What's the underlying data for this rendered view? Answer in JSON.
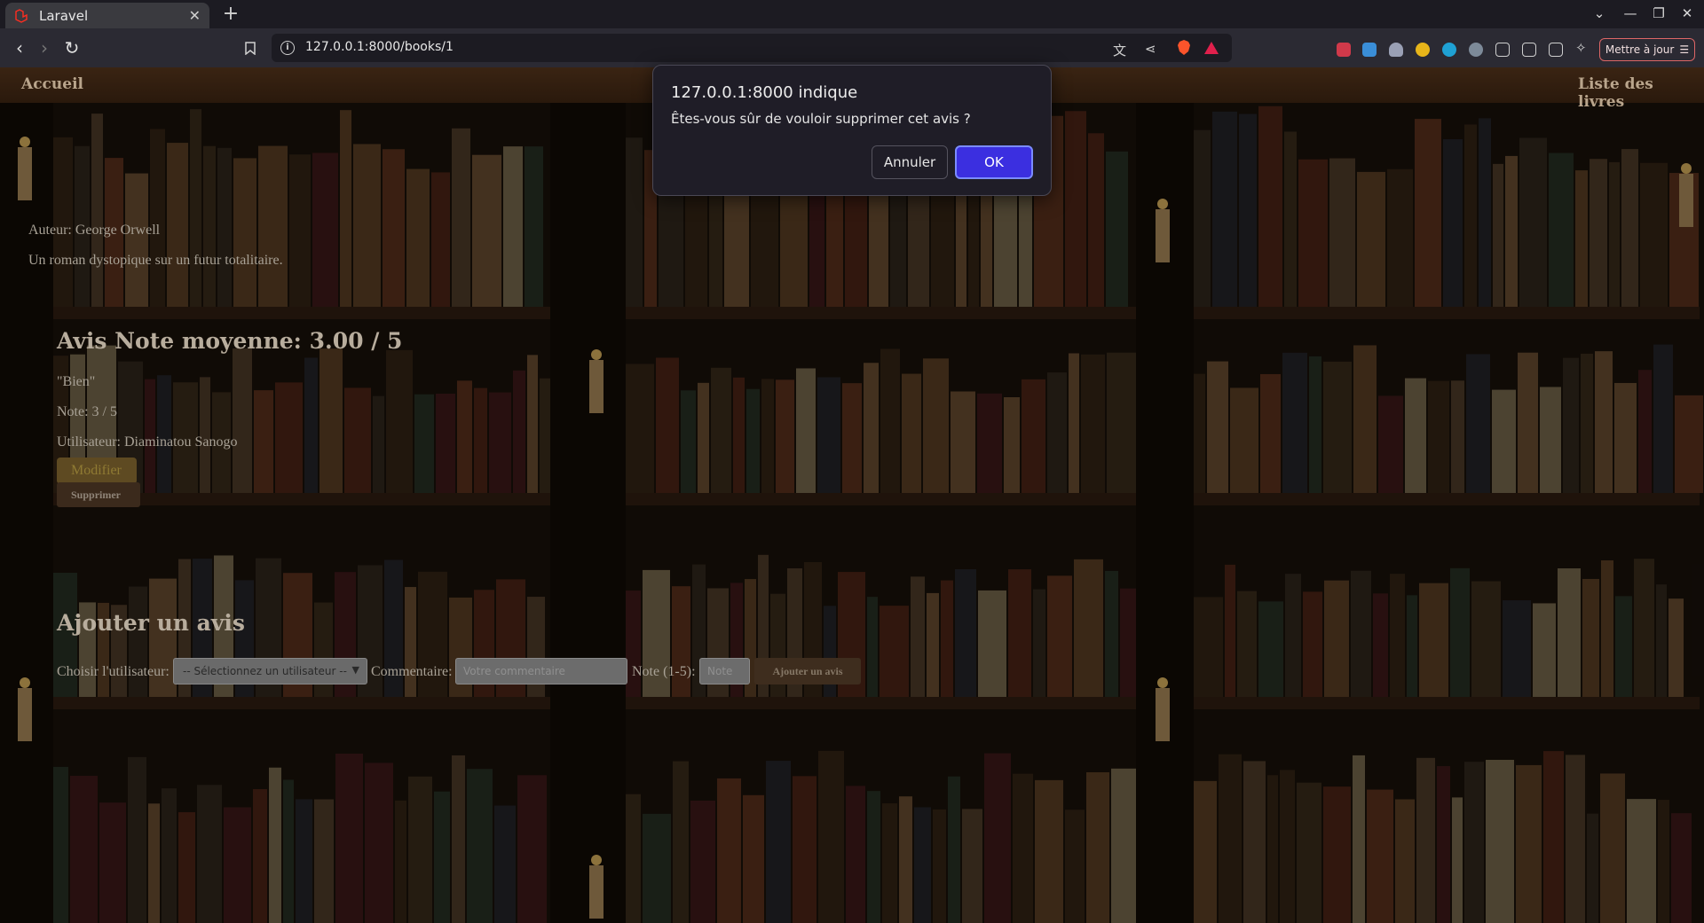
{
  "browser": {
    "tab_title": "Laravel",
    "tab_close": "✕",
    "new_tab": "+",
    "url": "127.0.0.1:8000/books/1",
    "update_button": "Mettre à jour",
    "window_controls": [
      "⌄",
      "—",
      "❐",
      "✕"
    ]
  },
  "nav": {
    "home": "Accueil",
    "books_list": "Liste des livres"
  },
  "book": {
    "author": "Auteur: George Orwell",
    "description": "Un roman dystopique sur un futur totalitaire."
  },
  "reviews": {
    "heading": "Avis Note moyenne: 3.00 / 5",
    "items": [
      {
        "comment": "\"Bien\"",
        "rating": "Note: 3 / 5",
        "user": "Utilisateur: Diaminatou Sanogo",
        "edit_label": "Modifier",
        "delete_label": "Supprimer"
      }
    ]
  },
  "add_review": {
    "heading": "Ajouter un avis",
    "user_label": "Choisir l'utilisateur:",
    "user_select_value": "-- Sélectionnez un utilisateur --",
    "comment_label": "Commentaire:",
    "comment_placeholder": "Votre commentaire",
    "note_label": "Note (1-5):",
    "note_placeholder": "Note",
    "submit_label": "Ajouter un avis"
  },
  "dialog": {
    "title": "127.0.0.1:8000 indique",
    "message": "Êtes-vous sûr de vouloir supprimer cet avis ?",
    "cancel_label": "Annuler",
    "ok_label": "OK",
    "ok_color": "#3b2fe0"
  }
}
